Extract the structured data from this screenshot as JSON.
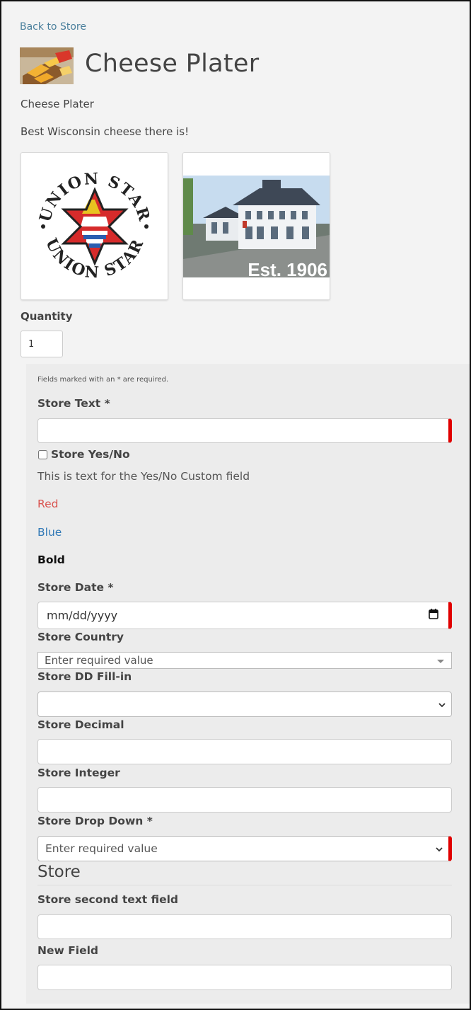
{
  "nav": {
    "back_label": "Back to Store"
  },
  "product": {
    "title": "Cheese Plater",
    "subtitle": "Cheese Plater",
    "description": "Best Wisconsin cheese there is!"
  },
  "images": {
    "logo_text_top": "UNION STAR",
    "logo_text_bottom": "UNION STAR",
    "building_caption": "Est. 1906"
  },
  "quantity": {
    "label": "Quantity",
    "value": "1"
  },
  "form": {
    "required_note": "Fields marked with an * are required.",
    "store_text_label": "Store Text *",
    "yes_no_label": "Store Yes/No",
    "custom_text": "This is text for the Yes/No Custom field",
    "red_text": "Red",
    "blue_text": "Blue",
    "bold_text": "Bold",
    "store_date_label": "Store Date *",
    "store_date_placeholder": "mm/dd/yyyy",
    "store_country_label": "Store Country",
    "store_country_placeholder": "Enter required value",
    "dd_fillin_label": "Store DD Fill-in",
    "decimal_label": "Store Decimal",
    "integer_label": "Store Integer",
    "drop_down_label": "Store Drop Down *",
    "drop_down_placeholder": "Enter required value",
    "section_title": "Store",
    "second_text_label": "Store second text field",
    "new_field_label": "New Field"
  },
  "colors": {
    "link": "#4a7f9c",
    "red_text": "#d9534f",
    "blue_text": "#337ab7",
    "required_marker": "#e00000"
  }
}
